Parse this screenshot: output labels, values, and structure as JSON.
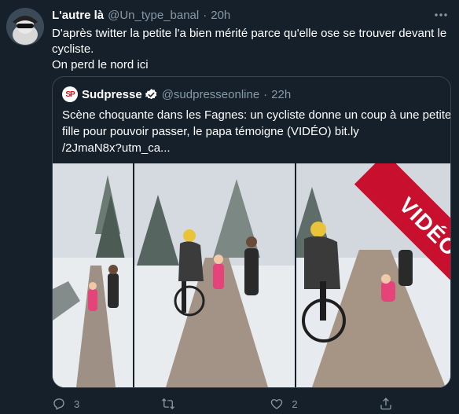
{
  "tweet": {
    "author_name": "L'autre là",
    "handle": "@Un_type_banal",
    "separator": "·",
    "time": "20h",
    "text_lines": [
      "D'après twitter la petite l'a bien mérité parce qu'elle ose se trouver devant le",
      "cycliste.",
      "On perd le nord ici"
    ],
    "more_icon": "more-dots-icon"
  },
  "quoted": {
    "logo_text": "SP",
    "author_name": "Sudpresse",
    "verified": true,
    "handle": "@sudpresseonline",
    "separator": "·",
    "time": "22h",
    "text_lines": [
      "Scène choquante dans les Fagnes: un cycliste donne un coup à une petite",
      "fille pour pouvoir passer, le papa témoigne (VIDÉO) bit.ly",
      "/2JmaN8x?utm_ca..."
    ],
    "banner_text": "VIDÉOS"
  },
  "actions": {
    "reply_count": "3",
    "retweet_count": "",
    "like_count": "2",
    "share_count": ""
  },
  "colors": {
    "background": "#15202b",
    "border": "#38444d",
    "muted": "#8899a6",
    "accent": "#1da1f2",
    "banner": "#c8102e"
  }
}
